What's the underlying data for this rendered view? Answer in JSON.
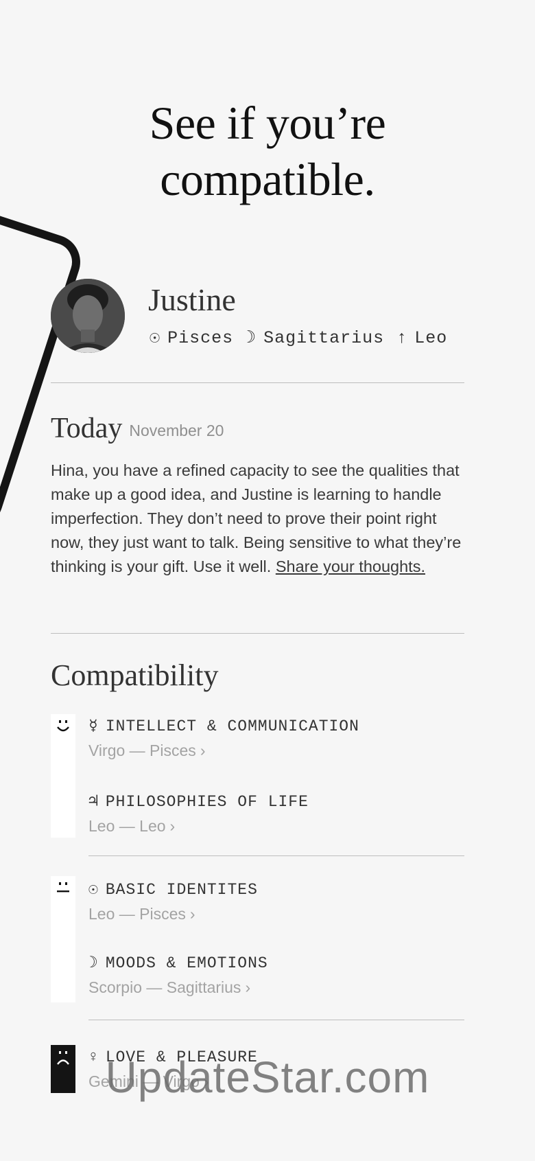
{
  "headline": {
    "line1": "See if you’re",
    "line2": "compatible."
  },
  "profile": {
    "name": "Justine",
    "sun_symbol": "☉",
    "sun": "Pisces",
    "moon_symbol": "☽",
    "moon": "Sagittarius",
    "rising_symbol": "↑",
    "rising": "Leo"
  },
  "today": {
    "title": "Today",
    "date": "November 20",
    "body": "Hina, you have a refined capacity to see the qualities that make up a good idea, and Justine is learning to handle imperfection. They don’t need to prove their point right now, they just want to talk. Being sensitive to what they’re thinking is your gift. Use it well.",
    "link": "Share your thoughts."
  },
  "compatibility": {
    "title": "Compatibility",
    "groups": [
      {
        "mood": "happy",
        "items": [
          {
            "glyph": "☿",
            "label": "INTELLECT & COMMUNICATION",
            "pair": "Virgo — Pisces",
            "chevron": "›"
          },
          {
            "glyph": "♃",
            "label": "PHILOSOPHIES OF LIFE",
            "pair": "Leo — Leo",
            "chevron": "›"
          }
        ]
      },
      {
        "mood": "neutral",
        "items": [
          {
            "glyph": "☉",
            "label": "BASIC IDENTITES",
            "pair": "Leo — Pisces",
            "chevron": "›"
          },
          {
            "glyph": "☽",
            "label": "MOODS & EMOTIONS",
            "pair": "Scorpio — Sagittarius",
            "chevron": "›"
          }
        ]
      },
      {
        "mood": "sad",
        "items": [
          {
            "glyph": "♀",
            "label": "LOVE & PLEASURE",
            "pair": "Gemini — Virgo",
            "chevron": "›"
          }
        ]
      }
    ]
  },
  "watermark": "UpdateStar.com",
  "colors": {
    "background": "#f6f6f6",
    "text": "#1a1a1a",
    "muted": "#a3a3a3",
    "rule": "#bdbdbd"
  }
}
